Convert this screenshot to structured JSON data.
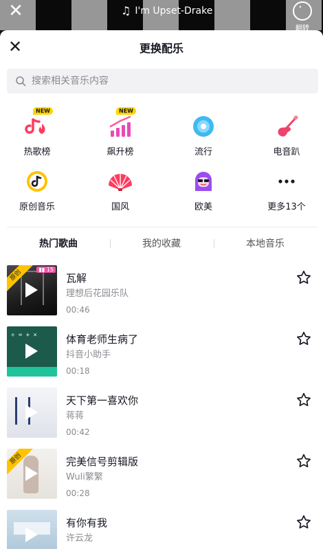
{
  "topbar": {
    "music_label": "I'm Upset-Drake",
    "flip_label": "翻转"
  },
  "header": {
    "title": "更换配乐"
  },
  "search": {
    "placeholder": "搜索相关音乐内容"
  },
  "categories": [
    {
      "label": "热歌榜",
      "badge": "NEW",
      "icon": "hot-chart-icon"
    },
    {
      "label": "飙升榜",
      "badge": "NEW",
      "icon": "rising-chart-icon"
    },
    {
      "label": "流行",
      "icon": "pop-disc-icon"
    },
    {
      "label": "电音趴",
      "icon": "guitar-icon"
    },
    {
      "label": "原创音乐",
      "icon": "original-music-icon"
    },
    {
      "label": "国风",
      "icon": "fan-icon"
    },
    {
      "label": "欧美",
      "icon": "western-avatar-icon"
    },
    {
      "label": "更多13个",
      "icon": "more-icon"
    }
  ],
  "tabs": [
    "热门歌曲",
    "我的收藏",
    "本地音乐"
  ],
  "songs": [
    {
      "title": "瓦解",
      "artist": "理想后花园乐队",
      "duration": "00:46",
      "original_badge": "原创",
      "rank_badge": "15"
    },
    {
      "title": "体育老师生病了",
      "artist": "抖音小助手",
      "duration": "00:18"
    },
    {
      "title": "天下第一喜欢你",
      "artist": "蒋蒋",
      "duration": "00:42"
    },
    {
      "title": "完美信号剪辑版",
      "artist": "Wuli繁繁",
      "duration": "00:28",
      "original_badge": "原创"
    },
    {
      "title": "有你有我",
      "artist": "许云龙",
      "duration": ""
    }
  ],
  "colors": {
    "accent_yellow": "#ffd500",
    "brand_pink": "#fe2c55"
  }
}
